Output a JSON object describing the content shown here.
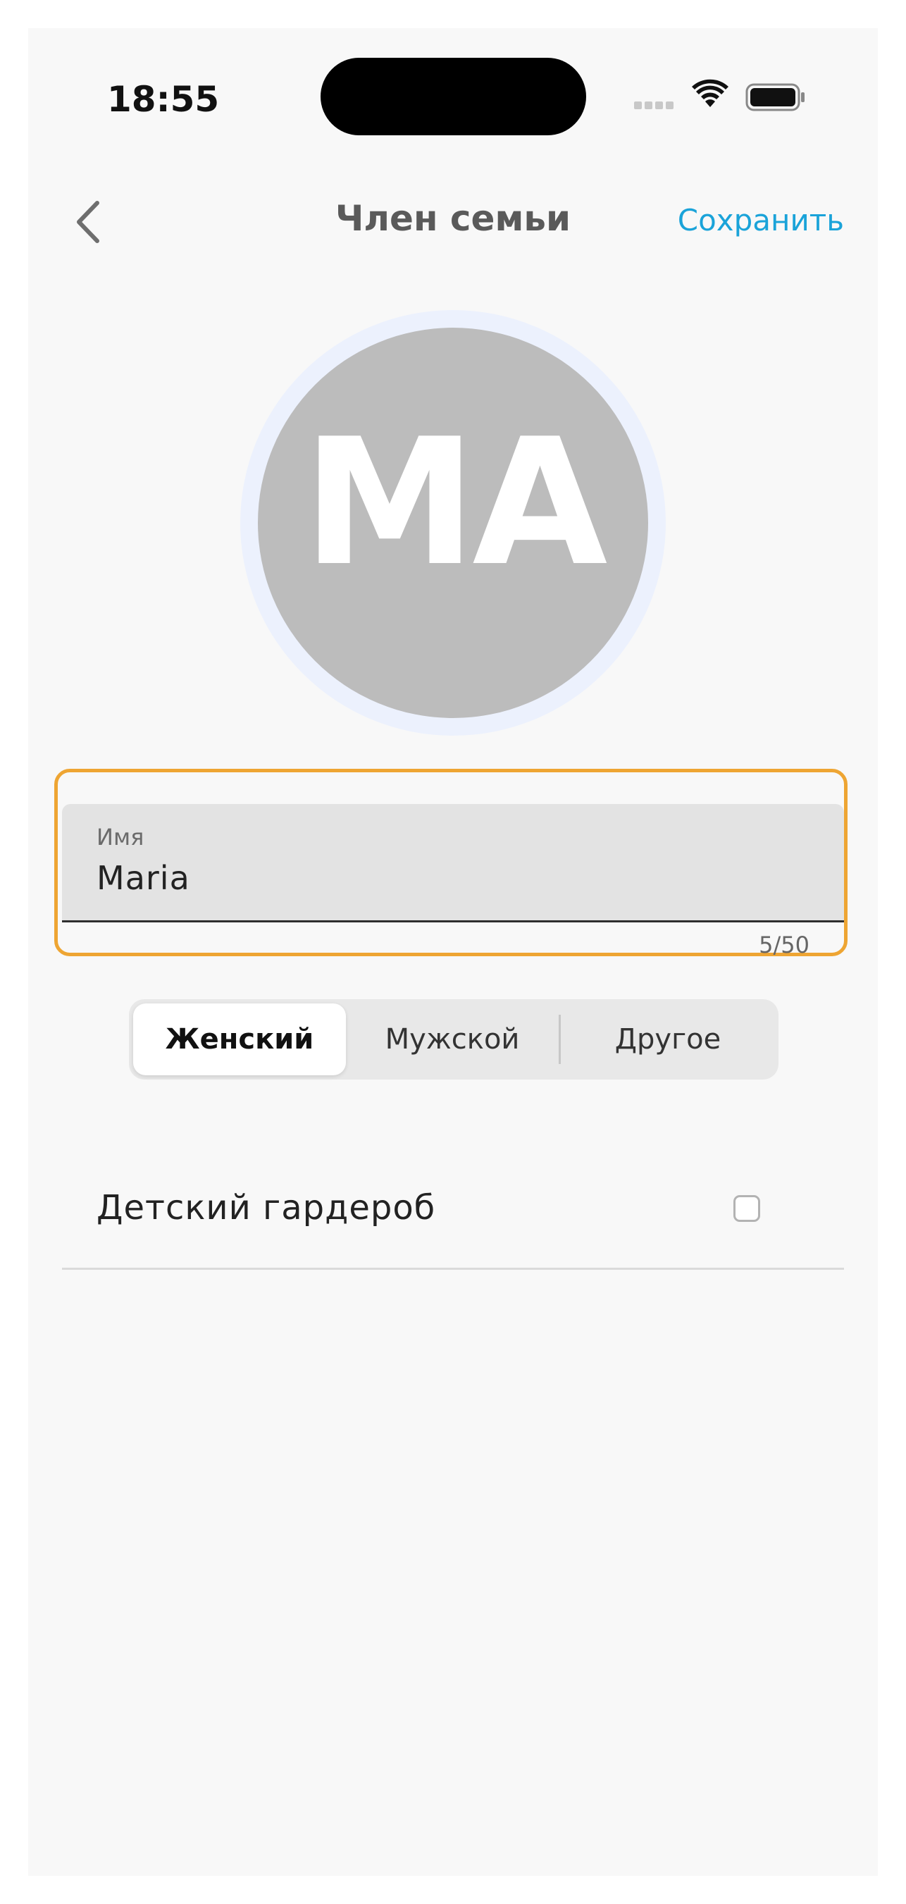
{
  "status_bar": {
    "time": "18:55"
  },
  "nav": {
    "title": "Член семьи",
    "save_label": "Сохранить",
    "back_icon": "chevron-left-icon"
  },
  "avatar": {
    "initials": "MA",
    "background_color": "#bcbcbc",
    "ring_color": "#ecf1fd"
  },
  "name_field": {
    "label": "Имя",
    "value": "Maria",
    "counter": "5/50",
    "highlight_color": "#eea533"
  },
  "gender": {
    "options": [
      "Женский",
      "Мужской",
      "Другое"
    ],
    "selected": "Женский"
  },
  "kids_wardrobe": {
    "label": "Детский гардероб",
    "checked": false
  },
  "colors": {
    "accent": "#1aa3d9",
    "background": "#f8f8f8"
  }
}
